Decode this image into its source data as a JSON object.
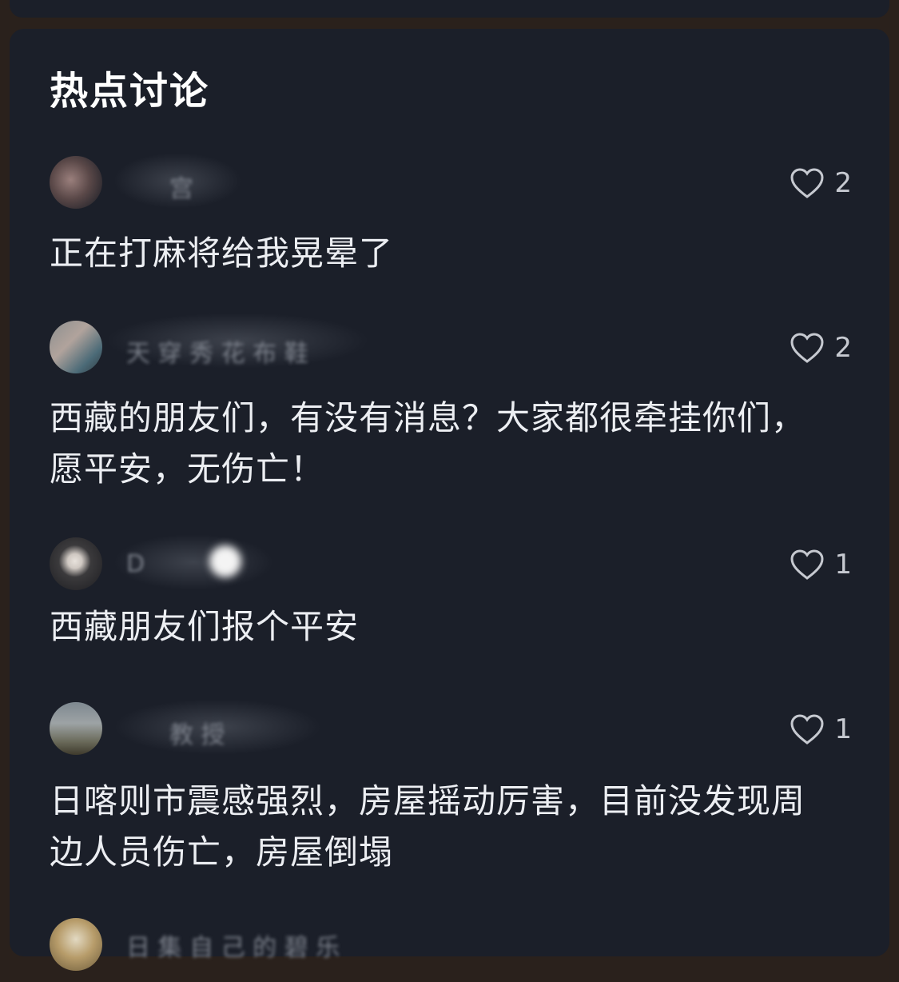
{
  "section": {
    "title": "热点讨论"
  },
  "comments": [
    {
      "username": "宫",
      "likes": "2",
      "text": "正在打麻将给我晃晕了"
    },
    {
      "username": "天 穿 秀 花 布 鞋",
      "likes": "2",
      "text": "西藏的朋友们，有没有消息？大家都很牵挂你们，愿平安，无伤亡！"
    },
    {
      "username": "D",
      "likes": "1",
      "text": "西藏朋友们报个平安"
    },
    {
      "username": "教 授",
      "likes": "1",
      "text": "日喀则市震感强烈，房屋摇动厉害，目前没发现周边人员伤亡，房屋倒塌"
    },
    {
      "username": "日 集 自 己 的 碧 乐"
    }
  ],
  "colors": {
    "card": "#1b1f29",
    "background": "#2a211c",
    "text": "#eceef2",
    "muted": "#c6c9d0"
  },
  "icons": {
    "like": "heart-outline-icon",
    "avatar": "avatar"
  }
}
